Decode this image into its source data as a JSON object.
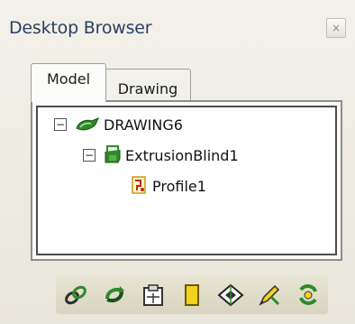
{
  "window": {
    "title": "Desktop Browser",
    "close_glyph": "×"
  },
  "tabs": [
    {
      "label": "Model",
      "active": true
    },
    {
      "label": "Drawing",
      "active": false
    }
  ],
  "tree": {
    "root": {
      "label": "DRAWING6",
      "expander": "−",
      "icon": "part-icon"
    },
    "child": {
      "label": "ExtrusionBlind1",
      "expander": "−",
      "icon": "extrusion-feature-icon"
    },
    "grandchild": {
      "label": "Profile1",
      "icon": "profile-sketch-icon"
    }
  },
  "toolbar": {
    "buttons": [
      {
        "icon": "link-chain-icon"
      },
      {
        "icon": "update-part-icon"
      },
      {
        "icon": "clipboard-icon"
      },
      {
        "icon": "yellow-note-icon"
      },
      {
        "icon": "view-orient-icon"
      },
      {
        "icon": "pencil-tool-icon"
      },
      {
        "icon": "rebuild-icon"
      }
    ]
  },
  "colors": {
    "title_text": "#2a3f63",
    "accent_green": "#2f8a2a",
    "accent_yellow": "#f2d21c"
  }
}
